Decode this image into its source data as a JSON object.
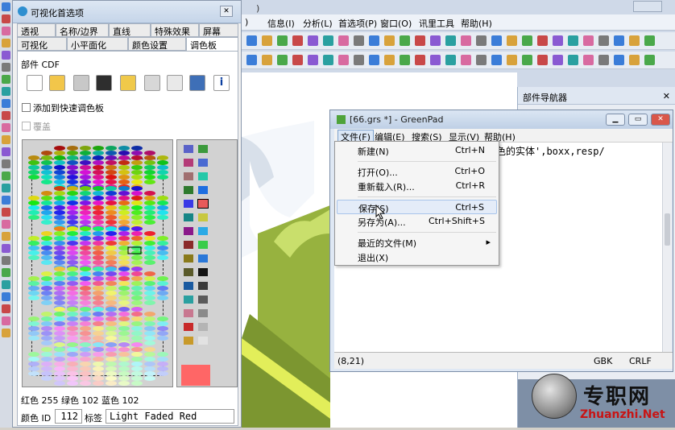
{
  "main_app": {
    "menu": [
      "信息(I)",
      "分析(L)",
      "首选项(P)",
      "窗口(O)",
      "讯里工具",
      "帮助(H)"
    ],
    "menu_prefix": ")",
    "nav_title": "部件导航器"
  },
  "dialog": {
    "title": "可视化首选项",
    "tabs_row1": [
      "透视",
      "名称/边界",
      "直线",
      "特殊效果",
      "屏幕"
    ],
    "tabs_row2": [
      "可视化",
      "小平面化",
      "颜色设置",
      "调色板"
    ],
    "active_tab": "调色板",
    "part_label": "部件 CDF",
    "file_icons": [
      "new-file-icon",
      "open-folder-icon",
      "save-disabled-icon",
      "save-icon",
      "properties-icon",
      "undo-disabled-icon",
      "redo-icon",
      "print-icon",
      "info-icon"
    ],
    "add_to_palette_label": "添加到快速调色板",
    "overwrite_label": "覆盖",
    "rgb_text": "红色 255 绿色 102 蓝色 102",
    "color_id_label": "颜色 ID",
    "color_id_value": "112",
    "label_label": "标签",
    "label_value": "Light Faded Red",
    "preview_color": "#ff6666",
    "swatches": [
      [
        "#5a62c8",
        "#3c9a3c"
      ],
      [
        "#b43c78",
        "#4a6ad2"
      ],
      [
        "#a07070",
        "#24c8a8"
      ],
      [
        "#2e7a2e",
        "#1e6ee0"
      ],
      [
        "#3a3ae6",
        "#e85a5a"
      ],
      [
        "#168686",
        "#c8c840"
      ],
      [
        "#8a1a8a",
        "#2aaae6"
      ],
      [
        "#8a2a2a",
        "#3acc4a"
      ],
      [
        "#8a7a1a",
        "#2a78d8"
      ],
      [
        "#5a5a2a",
        "#141414"
      ],
      [
        "#1a5aa0",
        "#3a3a3a"
      ],
      [
        "#2aa0a0",
        "#5a5a5a"
      ],
      [
        "#c87890",
        "#8a8a8a"
      ],
      [
        "#c82a2a",
        "#b4b4b4"
      ],
      [
        "#c89a2a",
        "#e2e2e2"
      ]
    ]
  },
  "greenpad": {
    "title": "[66.grs *] - GreenPad",
    "menu": [
      "文件(F)",
      "编辑(E)",
      "搜索(S)",
      "显示(V)",
      "帮助(H)"
    ],
    "text_line": "色的实体',boxx,resp/",
    "status": {
      "position": "(8,21)",
      "encoding": "GBK",
      "newline": "CRLF"
    },
    "file_menu": [
      {
        "label": "新建(N)",
        "shortcut": "Ctrl+N"
      },
      {
        "label": "打开(O)...",
        "shortcut": "Ctrl+O"
      },
      {
        "label": "重新载入(R)...",
        "shortcut": "Ctrl+R"
      },
      {
        "label": "保存(S)",
        "shortcut": "Ctrl+S"
      },
      {
        "label": "另存为(A)...",
        "shortcut": "Ctrl+Shift+S"
      },
      {
        "label": "最近的文件(M)",
        "shortcut": "▸"
      },
      {
        "label": "退出(X)",
        "shortcut": ""
      }
    ]
  },
  "watermark": {
    "name": "专职网",
    "url": "Zhuanzhi.Net"
  }
}
